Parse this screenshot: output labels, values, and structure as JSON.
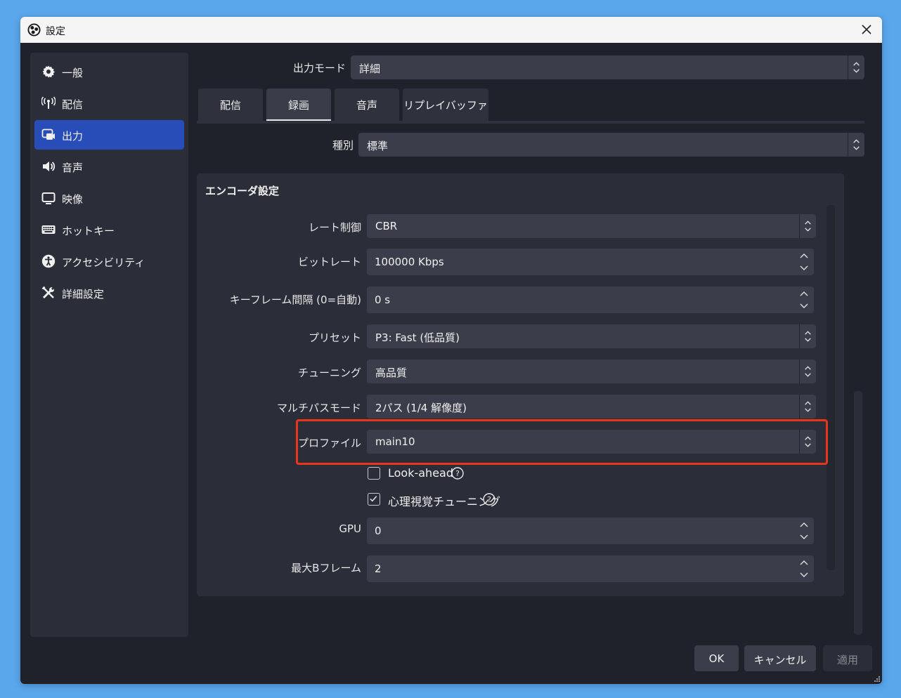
{
  "window": {
    "title": "設定"
  },
  "sidebar": {
    "items": [
      {
        "label": "一般",
        "icon": "gear-icon"
      },
      {
        "label": "配信",
        "icon": "antenna-icon"
      },
      {
        "label": "出力",
        "icon": "output-icon",
        "active": true
      },
      {
        "label": "音声",
        "icon": "speaker-icon"
      },
      {
        "label": "映像",
        "icon": "monitor-icon"
      },
      {
        "label": "ホットキー",
        "icon": "keyboard-icon"
      },
      {
        "label": "アクセシビリティ",
        "icon": "accessibility-icon"
      },
      {
        "label": "詳細設定",
        "icon": "tools-icon"
      }
    ]
  },
  "output_mode": {
    "label": "出力モード",
    "value": "詳細"
  },
  "tabs": [
    {
      "label": "配信"
    },
    {
      "label": "録画",
      "active": true
    },
    {
      "label": "音声"
    },
    {
      "label": "リプレイバッファ"
    }
  ],
  "type_field": {
    "label": "種別",
    "value": "標準"
  },
  "encoder": {
    "title": "エンコーダ設定",
    "rate_control": {
      "label": "レート制御",
      "value": "CBR"
    },
    "bitrate": {
      "label": "ビットレート",
      "value": "100000 Kbps"
    },
    "keyframe": {
      "label": "キーフレーム間隔 (0=自動)",
      "value": "0 s"
    },
    "preset": {
      "label": "プリセット",
      "value": "P3: Fast (低品質)"
    },
    "tuning": {
      "label": "チューニング",
      "value": "高品質"
    },
    "multipass": {
      "label": "マルチパスモード",
      "value": "2パス (1/4 解像度)"
    },
    "profile": {
      "label": "プロファイル",
      "value": "main10"
    },
    "lookahead": {
      "label": "Look-ahead",
      "checked": false
    },
    "psycho": {
      "label": "心理視覚チューニング",
      "checked": true
    },
    "gpu": {
      "label": "GPU",
      "value": "0"
    },
    "bframes": {
      "label": "最大Bフレーム",
      "value": "2"
    }
  },
  "buttons": {
    "ok": "OK",
    "cancel": "キャンセル",
    "apply": "適用"
  },
  "colors": {
    "accent": "#284cb8",
    "highlight": "#e8361d",
    "background": "#1f222b"
  }
}
